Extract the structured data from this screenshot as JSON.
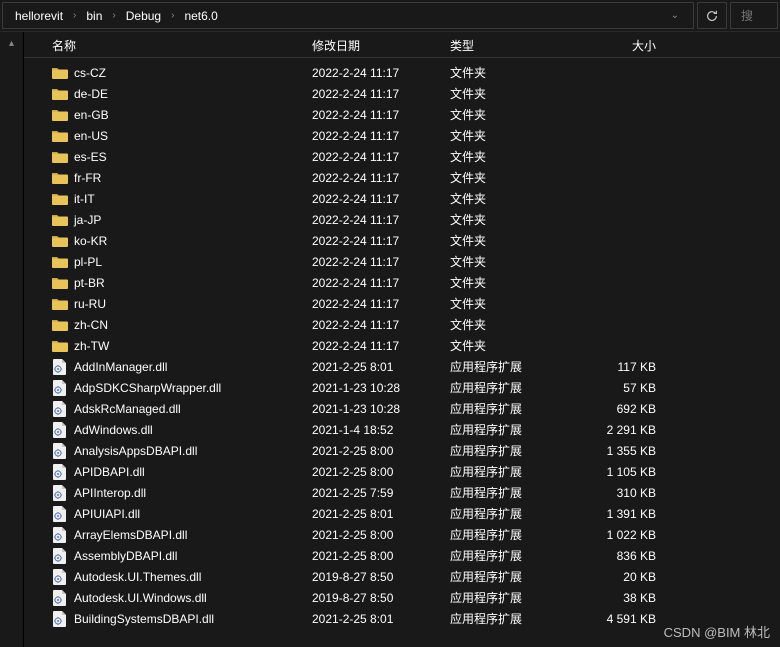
{
  "breadcrumb": [
    "hellorevit",
    "bin",
    "Debug",
    "net6.0"
  ],
  "search": {
    "placeholder": "搜"
  },
  "columns": {
    "name": "名称",
    "date": "修改日期",
    "type": "类型",
    "size": "大小"
  },
  "typeFolder": "文件夹",
  "typeDll": "应用程序扩展",
  "folders": [
    {
      "name": "cs-CZ",
      "date": "2022-2-24 11:17"
    },
    {
      "name": "de-DE",
      "date": "2022-2-24 11:17"
    },
    {
      "name": "en-GB",
      "date": "2022-2-24 11:17"
    },
    {
      "name": "en-US",
      "date": "2022-2-24 11:17"
    },
    {
      "name": "es-ES",
      "date": "2022-2-24 11:17"
    },
    {
      "name": "fr-FR",
      "date": "2022-2-24 11:17"
    },
    {
      "name": "it-IT",
      "date": "2022-2-24 11:17"
    },
    {
      "name": "ja-JP",
      "date": "2022-2-24 11:17"
    },
    {
      "name": "ko-KR",
      "date": "2022-2-24 11:17"
    },
    {
      "name": "pl-PL",
      "date": "2022-2-24 11:17"
    },
    {
      "name": "pt-BR",
      "date": "2022-2-24 11:17"
    },
    {
      "name": "ru-RU",
      "date": "2022-2-24 11:17"
    },
    {
      "name": "zh-CN",
      "date": "2022-2-24 11:17"
    },
    {
      "name": "zh-TW",
      "date": "2022-2-24 11:17"
    }
  ],
  "files": [
    {
      "name": "AddInManager.dll",
      "date": "2021-2-25 8:01",
      "size": "117 KB"
    },
    {
      "name": "AdpSDKCSharpWrapper.dll",
      "date": "2021-1-23 10:28",
      "size": "57 KB"
    },
    {
      "name": "AdskRcManaged.dll",
      "date": "2021-1-23 10:28",
      "size": "692 KB"
    },
    {
      "name": "AdWindows.dll",
      "date": "2021-1-4 18:52",
      "size": "2 291 KB"
    },
    {
      "name": "AnalysisAppsDBAPI.dll",
      "date": "2021-2-25 8:00",
      "size": "1 355 KB"
    },
    {
      "name": "APIDBAPI.dll",
      "date": "2021-2-25 8:00",
      "size": "1 105 KB"
    },
    {
      "name": "APIInterop.dll",
      "date": "2021-2-25 7:59",
      "size": "310 KB"
    },
    {
      "name": "APIUIAPI.dll",
      "date": "2021-2-25 8:01",
      "size": "1 391 KB"
    },
    {
      "name": "ArrayElemsDBAPI.dll",
      "date": "2021-2-25 8:00",
      "size": "1 022 KB"
    },
    {
      "name": "AssemblyDBAPI.dll",
      "date": "2021-2-25 8:00",
      "size": "836 KB"
    },
    {
      "name": "Autodesk.UI.Themes.dll",
      "date": "2019-8-27 8:50",
      "size": "20 KB"
    },
    {
      "name": "Autodesk.UI.Windows.dll",
      "date": "2019-8-27 8:50",
      "size": "38 KB"
    },
    {
      "name": "BuildingSystemsDBAPI.dll",
      "date": "2021-2-25 8:01",
      "size": "4 591 KB"
    }
  ],
  "watermark": "CSDN @BIM 林北"
}
